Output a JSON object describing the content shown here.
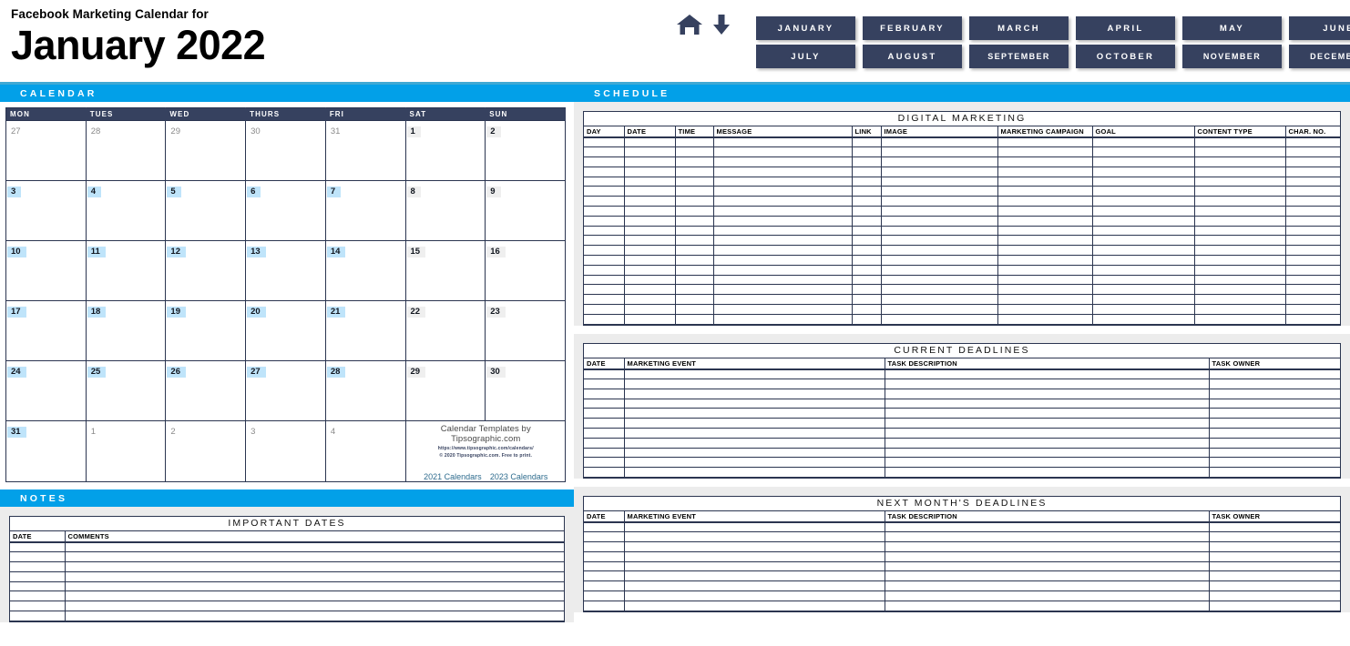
{
  "header": {
    "subtitle": "Facebook Marketing Calendar for",
    "title": "January 2022",
    "icons": {
      "home": "home-icon",
      "download": "down-arrow-icon"
    },
    "months": [
      "JANUARY",
      "FEBRUARY",
      "MARCH",
      "APRIL",
      "MAY",
      "JUNE",
      "JULY",
      "AUGUST",
      "SEPTEMBER",
      "OCTOBER",
      "NOVEMBER",
      "DECEMBER"
    ],
    "active_month": "JANUARY"
  },
  "colors": {
    "accent_blue": "#02A0E8",
    "navy": "#36415F",
    "weekday_highlight": "#BFE4FA",
    "weekend_highlight": "#EFEFEF",
    "panel_gray": "#ECECEC",
    "rule_teal": "#3FA9D4"
  },
  "sections": {
    "calendar": "CALENDAR",
    "notes": "NOTES",
    "schedule": "SCHEDULE"
  },
  "calendar": {
    "day_headers": [
      "MON",
      "TUES",
      "WED",
      "THURS",
      "FRI",
      "SAT",
      "SUN"
    ],
    "weeks": [
      [
        {
          "n": "27",
          "type": "muted"
        },
        {
          "n": "28",
          "type": "muted"
        },
        {
          "n": "29",
          "type": "muted"
        },
        {
          "n": "30",
          "type": "muted"
        },
        {
          "n": "31",
          "type": "muted"
        },
        {
          "n": "1",
          "type": "weekend"
        },
        {
          "n": "2",
          "type": "weekend"
        }
      ],
      [
        {
          "n": "3",
          "type": "weekday"
        },
        {
          "n": "4",
          "type": "weekday"
        },
        {
          "n": "5",
          "type": "weekday"
        },
        {
          "n": "6",
          "type": "weekday"
        },
        {
          "n": "7",
          "type": "weekday"
        },
        {
          "n": "8",
          "type": "weekend"
        },
        {
          "n": "9",
          "type": "weekend"
        }
      ],
      [
        {
          "n": "10",
          "type": "weekday"
        },
        {
          "n": "11",
          "type": "weekday"
        },
        {
          "n": "12",
          "type": "weekday"
        },
        {
          "n": "13",
          "type": "weekday"
        },
        {
          "n": "14",
          "type": "weekday"
        },
        {
          "n": "15",
          "type": "weekend"
        },
        {
          "n": "16",
          "type": "weekend"
        }
      ],
      [
        {
          "n": "17",
          "type": "weekday"
        },
        {
          "n": "18",
          "type": "weekday"
        },
        {
          "n": "19",
          "type": "weekday"
        },
        {
          "n": "20",
          "type": "weekday"
        },
        {
          "n": "21",
          "type": "weekday"
        },
        {
          "n": "22",
          "type": "weekend"
        },
        {
          "n": "23",
          "type": "weekend"
        }
      ],
      [
        {
          "n": "24",
          "type": "weekday"
        },
        {
          "n": "25",
          "type": "weekday"
        },
        {
          "n": "26",
          "type": "weekday"
        },
        {
          "n": "27",
          "type": "weekday"
        },
        {
          "n": "28",
          "type": "weekday"
        },
        {
          "n": "29",
          "type": "weekend"
        },
        {
          "n": "30",
          "type": "weekend"
        }
      ],
      [
        {
          "n": "31",
          "type": "weekday"
        },
        {
          "n": "1",
          "type": "muted"
        },
        {
          "n": "2",
          "type": "muted"
        },
        {
          "n": "3",
          "type": "muted"
        },
        {
          "n": "4",
          "type": "muted"
        },
        {
          "n": "",
          "type": "credit"
        },
        {
          "n": "",
          "type": "credit-span"
        }
      ]
    ],
    "credit": {
      "main": "Calendar Templates by Tipsographic.com",
      "url": "https://www.tipsographic.com/calendars/",
      "copyright": "© 2020 Tipsographic.com. Free to print.",
      "link_prev": "2021 Calendars",
      "link_next": "2023 Calendars"
    }
  },
  "tables": {
    "digital_marketing": {
      "title": "DIGITAL MARKETING",
      "columns": [
        "DAY",
        "DATE",
        "TIME",
        "MESSAGE",
        "LINK",
        "IMAGE",
        "MARKETING CAMPAIGN",
        "GOAL",
        "CONTENT TYPE",
        "CHAR. NO."
      ],
      "rows": 19
    },
    "current_deadlines": {
      "title": "CURRENT DEADLINES",
      "columns": [
        "DATE",
        "MARKETING EVENT",
        "TASK DESCRIPTION",
        "TASK OWNER"
      ],
      "rows": 11
    },
    "next_month_deadlines": {
      "title": "NEXT MONTH'S DEADLINES",
      "columns": [
        "DATE",
        "MARKETING EVENT",
        "TASK DESCRIPTION",
        "TASK OWNER"
      ],
      "rows": 9
    },
    "important_dates": {
      "title": "IMPORTANT DATES",
      "columns": [
        "DATE",
        "COMMENTS"
      ],
      "rows": 8
    }
  }
}
